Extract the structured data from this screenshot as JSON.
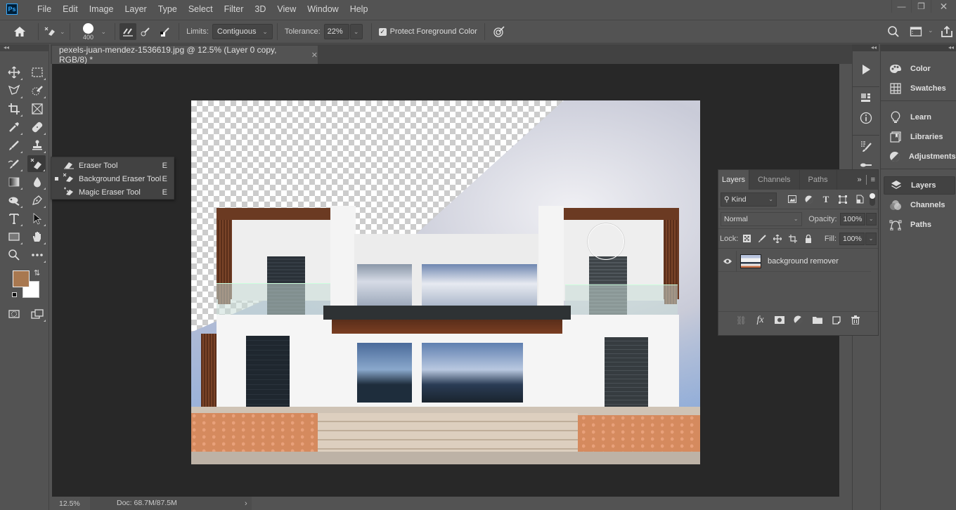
{
  "app": {
    "logo": "Ps",
    "menu": [
      "File",
      "Edit",
      "Image",
      "Layer",
      "Type",
      "Select",
      "Filter",
      "3D",
      "View",
      "Window",
      "Help"
    ],
    "window_controls": {
      "minimize": "—",
      "restore": "❐",
      "close": "✕"
    }
  },
  "options_bar": {
    "brush_size": "400",
    "limits_label": "Limits:",
    "limits_value": "Contiguous",
    "tolerance_label": "Tolerance:",
    "tolerance_value": "22%",
    "protect_fg_label": "Protect Foreground Color",
    "protect_fg_checked": true,
    "icons": [
      "home-icon",
      "background-eraser-icon",
      "brush-preset-icon",
      "sampling-continuous-icon",
      "sampling-once-icon",
      "sampling-background-swatch-icon",
      "pressure-size-icon",
      "search-icon",
      "workspace-icon",
      "share-icon"
    ]
  },
  "document": {
    "tab_title": "pexels-juan-mendez-1536619.jpg @ 12.5% (Layer 0 copy, RGB/8) *",
    "close": "✕"
  },
  "toolbar": {
    "tools": [
      "move",
      "marquee",
      "lasso",
      "quick-select",
      "crop",
      "frame",
      "eyedropper",
      "healing",
      "brush",
      "stamp",
      "history-brush",
      "eraser",
      "gradient",
      "blur",
      "dodge",
      "pen",
      "type",
      "path-select",
      "rectangle",
      "hand",
      "zoom",
      "more"
    ],
    "active_tool": "eraser",
    "foreground_color": "#a87850",
    "background_color": "#ffffff"
  },
  "flyout": {
    "items": [
      {
        "label": "Eraser Tool",
        "key": "E",
        "selected": false
      },
      {
        "label": "Background Eraser Tool",
        "key": "E",
        "selected": true
      },
      {
        "label": "Magic Eraser Tool",
        "key": "E",
        "selected": false
      }
    ]
  },
  "status": {
    "zoom": "12.5%",
    "doc_size": "Doc: 68.7M/87.5M",
    "arrow": "›"
  },
  "right_dock": {
    "buttons": [
      "play-icon",
      "3d-properties-icon",
      "info-icon",
      "brush-settings-icon",
      "clone-source-icon"
    ]
  },
  "right_panel": {
    "group1": [
      "Color",
      "Swatches"
    ],
    "group2": [
      "Learn",
      "Libraries",
      "Adjustments"
    ],
    "group3": [
      "Layers",
      "Channels",
      "Paths"
    ],
    "active": "Layers"
  },
  "layers_panel": {
    "tabs": [
      "Layers",
      "Channels",
      "Paths"
    ],
    "active_tab": "Layers",
    "filter_kind": "Kind",
    "blend_mode": "Normal",
    "opacity_label": "Opacity:",
    "opacity": "100%",
    "lock_label": "Lock:",
    "fill_label": "Fill:",
    "fill": "100%",
    "layers": [
      {
        "name": "background remover",
        "visible": true
      }
    ]
  }
}
